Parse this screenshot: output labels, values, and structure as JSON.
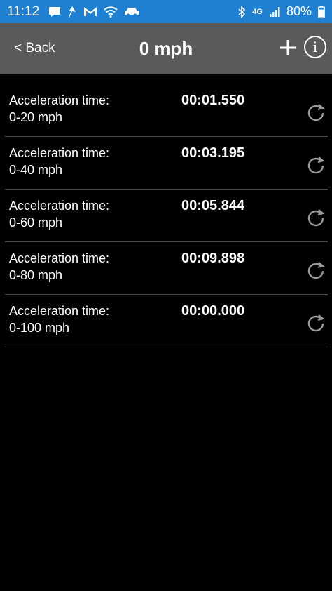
{
  "status_bar": {
    "time": "11:12",
    "network": "4G",
    "battery": "80%",
    "icons_left": [
      "message-icon",
      "route-icon",
      "gmail-icon",
      "wifi-icon",
      "car-icon"
    ],
    "icons_right": [
      "bluetooth-icon",
      "network-icon",
      "signal-icon",
      "battery-icon"
    ]
  },
  "header": {
    "back_label": "< Back",
    "title": "0 mph",
    "add_icon": "plus-icon",
    "info_icon": "info-icon",
    "info_glyph": "i"
  },
  "rows": [
    {
      "label_line1": "Acceleration time:",
      "label_line2": "0-20 mph",
      "time": "00:01.550"
    },
    {
      "label_line1": "Acceleration time:",
      "label_line2": "0-40 mph",
      "time": "00:03.195"
    },
    {
      "label_line1": "Acceleration time:",
      "label_line2": "0-60 mph",
      "time": "00:05.844"
    },
    {
      "label_line1": "Acceleration time:",
      "label_line2": "0-80 mph",
      "time": "00:09.898"
    },
    {
      "label_line1": "Acceleration time:",
      "label_line2": "0-100 mph",
      "time": "00:00.000"
    }
  ],
  "colors": {
    "status_bar": "#1f7fd0",
    "header": "#5a5a5a",
    "background": "#000000",
    "divider": "#4a4a4a",
    "reset_icon": "#9a9a9a"
  }
}
